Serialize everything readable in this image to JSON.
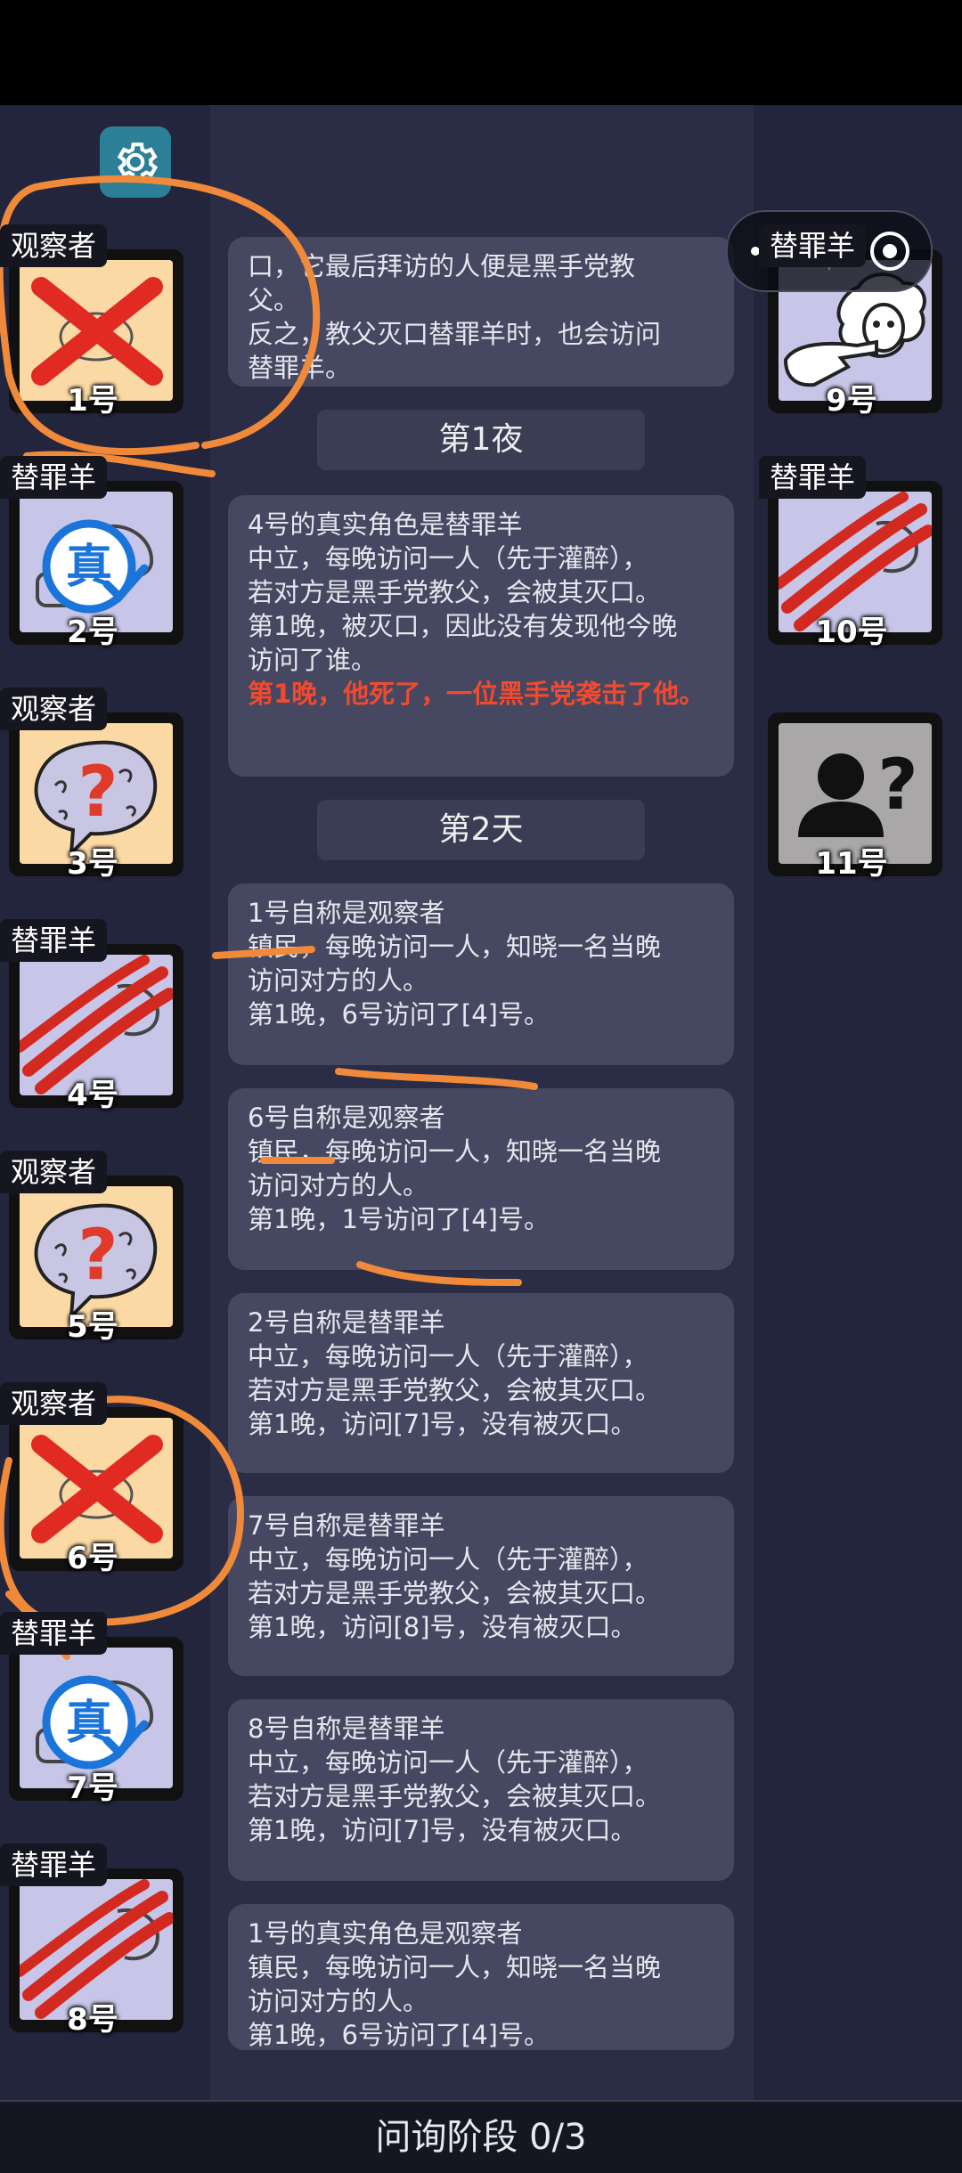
{
  "capsule": {
    "menu_icon": "more-dots-icon",
    "close_icon": "target-close-icon"
  },
  "players": [
    {
      "id": "p1",
      "num": "1号",
      "tag": "观察者",
      "face": "yellow",
      "art": "crossed",
      "side": "left"
    },
    {
      "id": "p2",
      "num": "2号",
      "tag": "替罪羊",
      "face": "lav",
      "art": "true",
      "side": "left"
    },
    {
      "id": "p3",
      "num": "3号",
      "tag": "观察者",
      "face": "yellow",
      "art": "question",
      "side": "left"
    },
    {
      "id": "p4",
      "num": "4号",
      "tag": "替罪羊",
      "face": "lav",
      "art": "slash",
      "side": "left"
    },
    {
      "id": "p5",
      "num": "5号",
      "tag": "观察者",
      "face": "yellow",
      "art": "question",
      "side": "left"
    },
    {
      "id": "p6",
      "num": "6号",
      "tag": "观察者",
      "face": "yellow",
      "art": "crossed",
      "side": "left"
    },
    {
      "id": "p7",
      "num": "7号",
      "tag": "替罪羊",
      "face": "lav",
      "art": "true",
      "side": "left"
    },
    {
      "id": "p8",
      "num": "8号",
      "tag": "替罪羊",
      "face": "lav",
      "art": "slash",
      "side": "left"
    },
    {
      "id": "p9",
      "num": "9号",
      "tag": "替罪羊",
      "face": "lav",
      "art": "sheep",
      "side": "right"
    },
    {
      "id": "p10",
      "num": "10号",
      "tag": "替罪羊",
      "face": "lav",
      "art": "slash",
      "side": "right"
    },
    {
      "id": "p11",
      "num": "11号",
      "tag": "",
      "face": "grey",
      "art": "unknown",
      "side": "right"
    }
  ],
  "log": {
    "top_partial": [
      "口，它最后拜访的人便是黑手党教",
      "父。",
      "反之，教父灭口替罪羊时，也会访问",
      "替罪羊。"
    ],
    "phase_night1": "第1夜",
    "reveal_4": [
      "4号的真实角色是替罪羊",
      "中立，每晚访问一人（先于灌醉），",
      "若对方是黑手党教父，会被其灭口。",
      "第1晚，被灭口，因此没有发现他今晚",
      "访问了谁。"
    ],
    "reveal_4_red": "第1晚，他死了，一位黑手党袭击了他。",
    "phase_day2": "第2天",
    "claim_1": [
      "1号自称是观察者",
      "镇民，每晚访问一人，知晓一名当晚",
      "访问对方的人。",
      "第1晚，6号访问了[4]号。"
    ],
    "claim_6": [
      "6号自称是观察者",
      "镇民，每晚访问一人，知晓一名当晚",
      "访问对方的人。",
      "第1晚，1号访问了[4]号。"
    ],
    "claim_2": [
      "2号自称是替罪羊",
      "中立，每晚访问一人（先于灌醉），",
      "若对方是黑手党教父，会被其灭口。",
      "第1晚，访问[7]号，没有被灭口。"
    ],
    "claim_7": [
      "7号自称是替罪羊",
      "中立，每晚访问一人（先于灌醉），",
      "若对方是黑手党教父，会被其灭口。",
      "第1晚，访问[8]号，没有被灭口。"
    ],
    "claim_8": [
      "8号自称是替罪羊",
      "中立，每晚访问一人（先于灌醉），",
      "若对方是黑手党教父，会被其灭口。",
      "第1晚，访问[7]号，没有被灭口。"
    ],
    "reveal_1": [
      "1号的真实角色是观察者",
      "镇民，每晚访问一人，知晓一名当晚",
      "访问对方的人。",
      "第1晚，6号访问了[4]号。"
    ]
  },
  "bottom": {
    "label": "问询阶段 0/3"
  },
  "colors": {
    "accent_red": "#f04a30",
    "annotation_orange": "#f08a3a"
  }
}
